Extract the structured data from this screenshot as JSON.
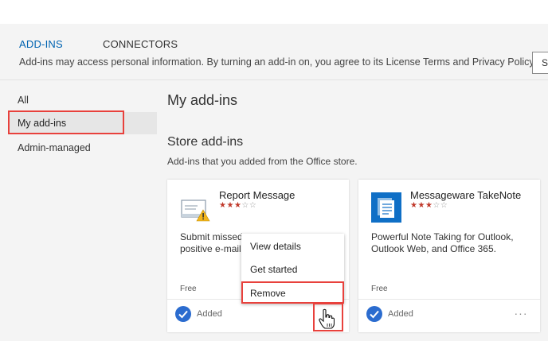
{
  "tabs": [
    {
      "label": "ADD-INS",
      "active": true
    },
    {
      "label": "CONNECTORS",
      "active": false
    }
  ],
  "notice": "Add-ins may access personal information. By turning an add-in on, you agree to its License Terms and Privacy Policy.",
  "search_button_label": "Se",
  "sidebar": {
    "items": [
      {
        "label": "All"
      },
      {
        "label": "My add-ins",
        "selected": true
      },
      {
        "label": "Admin-managed"
      }
    ]
  },
  "main": {
    "heading": "My add-ins",
    "section_title": "Store add-ins",
    "section_subtitle": "Add-ins that you added from the Office store."
  },
  "cards": [
    {
      "title": "Report Message",
      "rating": 3,
      "rating_max": 5,
      "description_line1": "Submit missed",
      "description_line2": "positive e-mails",
      "price": "Free",
      "status": "Added",
      "icon": "envelope-warning-icon"
    },
    {
      "title": "Messageware TakeNote",
      "rating": 3,
      "rating_max": 5,
      "description_line1": "Powerful Note Taking for Outlook,",
      "description_line2": "Outlook Web, and Office 365.",
      "price": "Free",
      "status": "Added",
      "icon": "notes-icon"
    }
  ],
  "context_menu": {
    "items": [
      "View details",
      "Get started",
      "Remove"
    ]
  },
  "colors": {
    "accent": "#0063b1",
    "highlight": "#e8413c",
    "star": "#c0392b"
  }
}
